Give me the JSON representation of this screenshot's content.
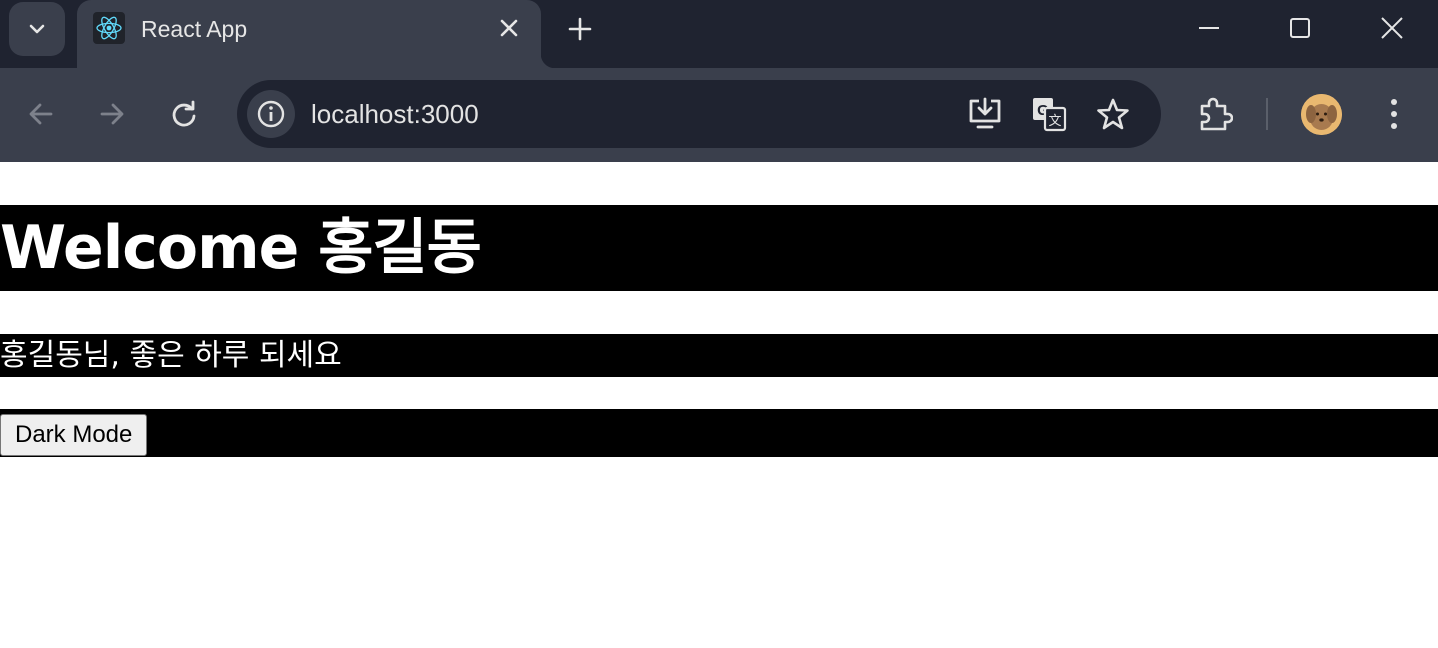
{
  "browser": {
    "tab": {
      "title": "React App",
      "favicon": "react-logo-icon"
    },
    "address": {
      "url": "localhost:3000"
    },
    "colors": {
      "frame": "#1f2330",
      "toolbar": "#3a3f4c",
      "react_blue": "#61dafb"
    }
  },
  "page": {
    "heading": "Welcome 홍길동",
    "greeting": "홍길동님, 좋은 하루 되세요",
    "button_label": "Dark Mode",
    "colors": {
      "band": "#000000",
      "text": "#ffffff"
    }
  }
}
